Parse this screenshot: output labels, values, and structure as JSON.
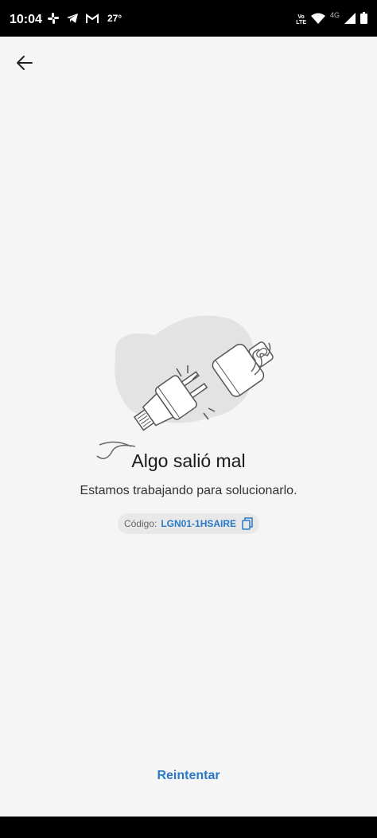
{
  "status_bar": {
    "time": "10:04",
    "temperature": "27°",
    "volte_line1": "Vo",
    "volte_line2": "LTE",
    "network": "4G"
  },
  "header": {
    "back_icon": "arrow-left-icon"
  },
  "error": {
    "title": "Algo salió mal",
    "message": "Estamos trabajando para solucionarlo.",
    "code_label": "Código:",
    "code_value": "LGN01-1HSAIRE"
  },
  "actions": {
    "retry_label": "Reintentar"
  },
  "colors": {
    "background": "#f5f5f5",
    "accent": "#2a78c8",
    "text_primary": "#1a1a1a"
  }
}
